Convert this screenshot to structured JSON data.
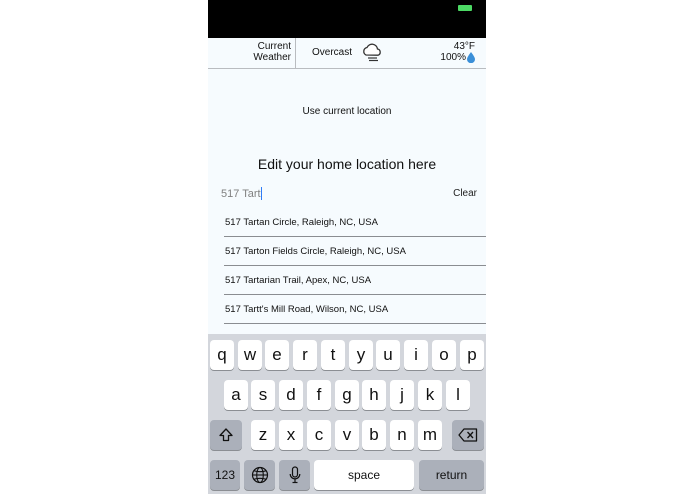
{
  "weather": {
    "current_label_line1": "Current",
    "current_label_line2": "Weather",
    "condition": "Overcast",
    "condition_icon": "cloud-rain-icon",
    "temperature": "43°F",
    "humidity": "100%",
    "humidity_icon": "water-drop-icon"
  },
  "location": {
    "use_current_label": "Use current location",
    "heading": "Edit your home location here",
    "input_value": "517 Tart",
    "clear_label": "Clear",
    "suggestions": [
      "517 Tartan Circle, Raleigh, NC, USA",
      "517 Tarton Fields Circle, Raleigh, NC, USA",
      "517 Tartarian Trail, Apex, NC, USA",
      "517 Tartt's Mill Road, Wilson, NC, USA"
    ]
  },
  "keyboard": {
    "row1": [
      "q",
      "w",
      "e",
      "r",
      "t",
      "y",
      "u",
      "i",
      "o",
      "p"
    ],
    "row2": [
      "a",
      "s",
      "d",
      "f",
      "g",
      "h",
      "j",
      "k",
      "l"
    ],
    "row3": [
      "z",
      "x",
      "c",
      "v",
      "b",
      "n",
      "m"
    ],
    "shift_icon": "shift-icon",
    "backspace_icon": "backspace-icon",
    "numbers_label": "123",
    "globe_icon": "globe-icon",
    "mic_icon": "microphone-icon",
    "space_label": "space",
    "return_label": "return"
  },
  "colors": {
    "battery": "#4cd964",
    "cursor": "#2f7cf6",
    "drop": "#3a8fd8"
  }
}
